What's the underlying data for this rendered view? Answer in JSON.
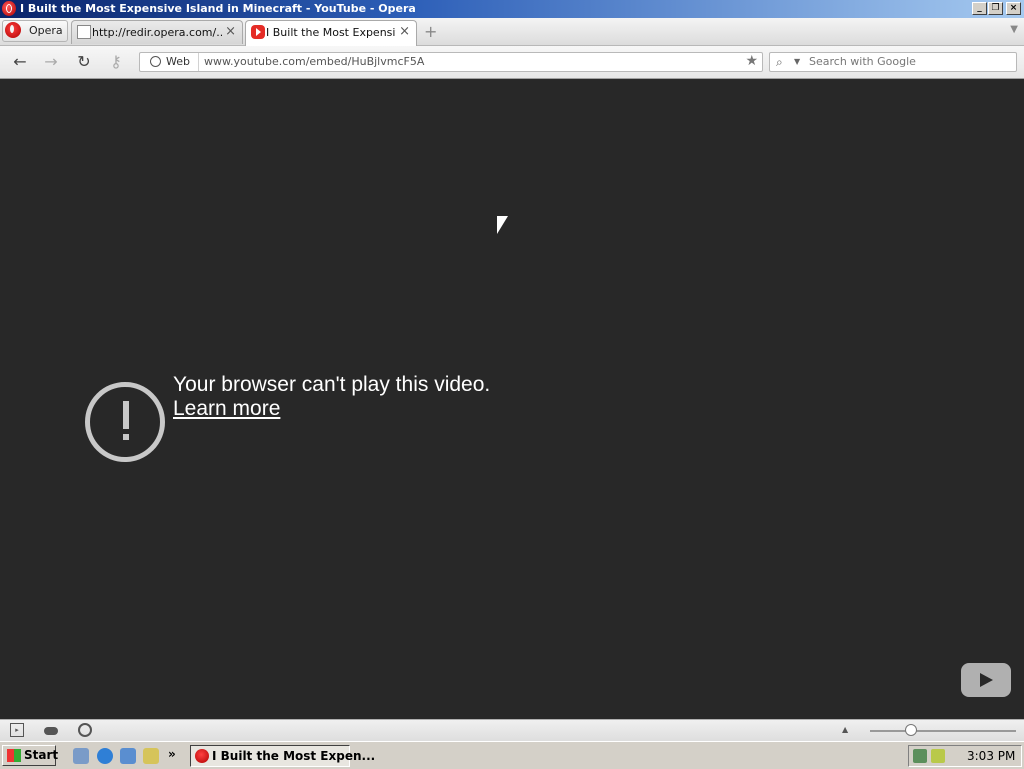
{
  "window": {
    "title": "I Built the Most Expensive Island in Minecraft - YouTube - Opera",
    "controls": {
      "minimize": "_",
      "maximize": "❐",
      "close": "×"
    }
  },
  "tabs": {
    "menu_label": "Opera",
    "items": [
      {
        "title": "http://redir.opera.com/...",
        "icon": "document-icon",
        "active": false
      },
      {
        "title": "I Built the Most Expensiv...",
        "icon": "youtube-icon",
        "active": true
      }
    ],
    "close_glyph": "×",
    "new_tab_glyph": "+"
  },
  "navigation": {
    "back": "←",
    "forward": "→",
    "reload": "↻",
    "key": "⚷",
    "web_label": "Web",
    "url": "www.youtube.com/embed/HuBjlvmcF5A",
    "search_placeholder": "Search with Google"
  },
  "content": {
    "message": "Your browser can't play this video.",
    "link": "Learn more",
    "background_color": "#282828"
  },
  "statusbar": {
    "zoom_level": 0.28
  },
  "taskbar": {
    "start_label": "Start",
    "chevron": "»",
    "task_label": "I Built the Most Expen...",
    "clock": "3:03 PM"
  }
}
